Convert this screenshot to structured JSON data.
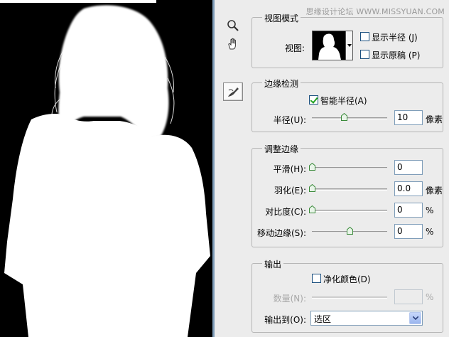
{
  "watermark": "思缘设计论坛 WWW.MISSYUAN.COM",
  "tools": {
    "zoom": "zoom-tool",
    "hand": "hand-tool",
    "refine_radius": "refine-radius-tool"
  },
  "view_mode": {
    "title": "视图模式",
    "view_label": "视图:",
    "show_radius": {
      "label": "显示半径 (J)",
      "checked": false
    },
    "show_original": {
      "label": "显示原稿 (P)",
      "checked": false
    }
  },
  "edge_detection": {
    "title": "边缘检测",
    "smart_radius": {
      "label": "智能半径(A)",
      "checked": true
    },
    "radius": {
      "label": "半径(U):",
      "value": "10",
      "unit": "像素",
      "slider_fraction": 0.42
    }
  },
  "adjust_edge": {
    "title": "调整边缘",
    "smooth": {
      "label": "平滑(H):",
      "value": "0",
      "unit": "",
      "slider_fraction": 0.0
    },
    "feather": {
      "label": "羽化(E):",
      "value": "0.0",
      "unit": "像素",
      "slider_fraction": 0.0
    },
    "contrast": {
      "label": "对比度(C):",
      "value": "0",
      "unit": "%",
      "slider_fraction": 0.0
    },
    "shift_edge": {
      "label": "移动边缘(S):",
      "value": "0",
      "unit": "%",
      "slider_fraction": 0.5
    }
  },
  "output": {
    "title": "输出",
    "decontaminate": {
      "label": "净化颜色(D)",
      "checked": false
    },
    "amount": {
      "label": "数量(N):",
      "value": "",
      "unit": "%"
    },
    "output_to": {
      "label": "输出到(O):",
      "value": "选区"
    }
  }
}
